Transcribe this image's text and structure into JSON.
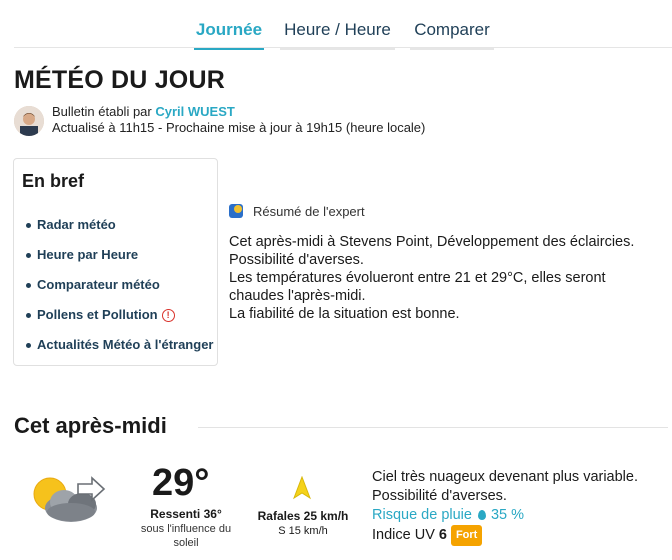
{
  "tabs": [
    "Journée",
    "Heure / Heure",
    "Comparer"
  ],
  "title": "MÉTÉO DU JOUR",
  "bulletin": {
    "prefix": "Bulletin établi par",
    "author": "Cyril WUEST",
    "update": "Actualisé à 11h15 - Prochaine mise à jour à 19h15 (heure locale)"
  },
  "brief": {
    "title": "En bref",
    "items": [
      "Radar météo",
      "Heure par Heure",
      "Comparateur météo",
      "Pollens et Pollution",
      "Actualités Météo à l'étranger"
    ]
  },
  "expert": {
    "label": "Résumé de l'expert",
    "lines": [
      "Cet après-midi à Stevens Point, Développement des éclaircies.",
      "Possibilité d'averses.",
      "Les températures évolueront entre 21 et 29°C, elles seront",
      "chaudes l'après-midi.",
      "La fiabilité de la situation est bonne."
    ]
  },
  "afternoon": {
    "title": "Cet après-midi",
    "temp": "29°",
    "feel": "Ressenti 36°",
    "feel_sub": "sous l'influence du soleil",
    "wind_main": "Rafales 25 km/h",
    "wind_sub": "S 15 km/h",
    "desc1": "Ciel très nuageux devenant plus variable.",
    "desc2": "Possibilité d'averses.",
    "rain_label": "Risque de pluie",
    "rain_value": "35 %",
    "uv_label": "Indice UV",
    "uv_value": "6",
    "uv_badge": "Fort"
  },
  "colors": {
    "accent": "#2aa8c4",
    "navy": "#1f3f57",
    "uv": "#f5a300",
    "wind": "#f5d21a"
  },
  "icons": {
    "weather": "sun-cloud-wind-icon",
    "wind": "wind-direction-arrow-icon",
    "drop": "rain-drop-icon",
    "alert": "alert-circle-icon"
  }
}
